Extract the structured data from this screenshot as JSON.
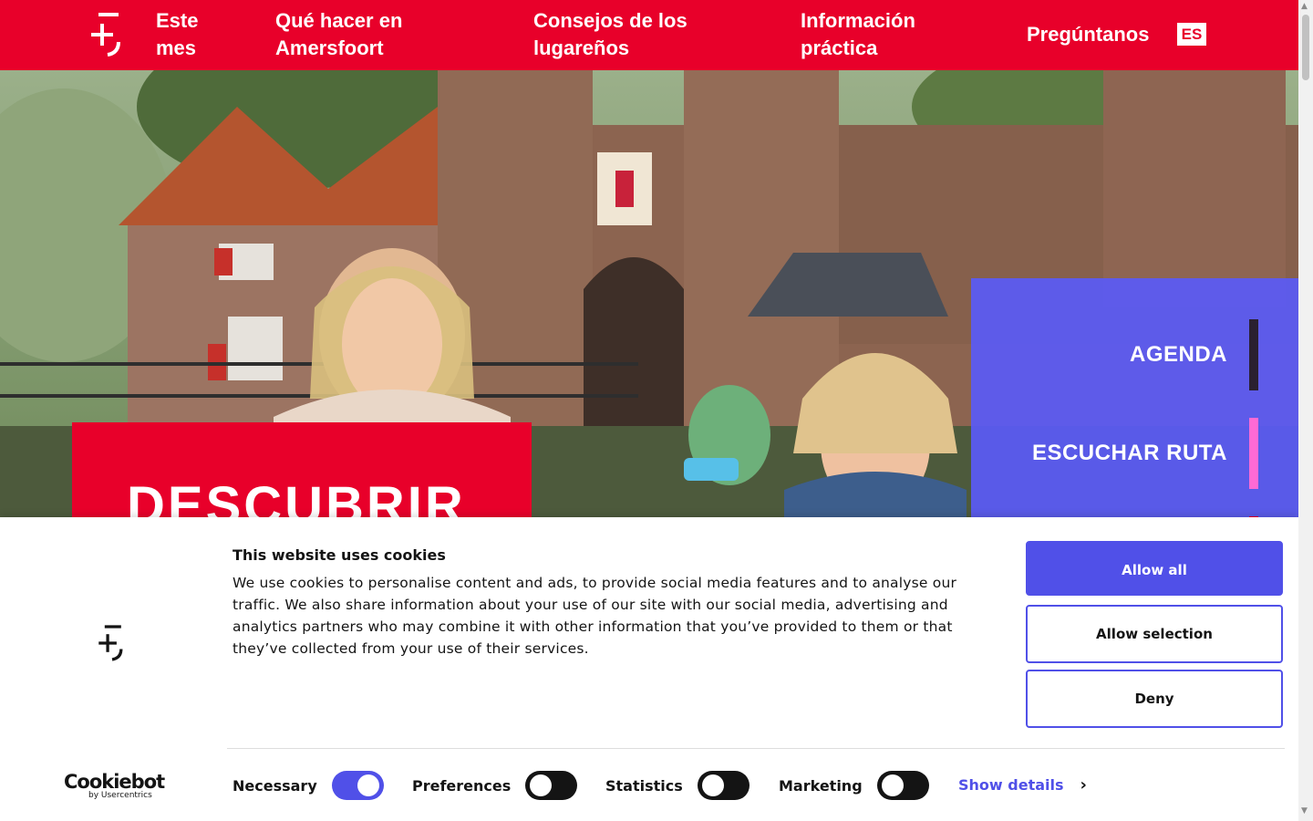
{
  "nav": {
    "items": [
      {
        "line1": "Este",
        "line2": "mes"
      },
      {
        "line1": "Qué hacer en",
        "line2": "Amersfoort"
      },
      {
        "line1": "Consejos de los",
        "line2": "lugareños"
      },
      {
        "line1": "Información",
        "line2": "práctica"
      }
    ],
    "ask": "Pregúntanos",
    "lang": "ES"
  },
  "hero": {
    "title": "DESCUBRIR",
    "quick_links": [
      {
        "label": "AGENDA",
        "accent": "#2a2030"
      },
      {
        "label": "ESCUCHAR RUTA",
        "accent": "#ff6ad5"
      }
    ]
  },
  "cookie": {
    "title": "This website uses cookies",
    "text": "We use cookies to personalise content and ads, to provide social media features and to analyse our traffic. We also share information about your use of our site with our social media, advertising and analytics partners who may combine it with other information that you’ve provided to them or that they’ve collected from your use of their services.",
    "buttons": {
      "allow_all": "Allow all",
      "allow_selection": "Allow selection",
      "deny": "Deny"
    },
    "toggles": [
      {
        "label": "Necessary",
        "on": true
      },
      {
        "label": "Preferences",
        "on": false
      },
      {
        "label": "Statistics",
        "on": false
      },
      {
        "label": "Marketing",
        "on": false
      }
    ],
    "show_details": "Show details",
    "brand": {
      "name": "Cookiebot",
      "by": "by Usercentrics"
    }
  },
  "colors": {
    "brand_red": "#e8002a",
    "accent_blue": "#5050e8"
  }
}
